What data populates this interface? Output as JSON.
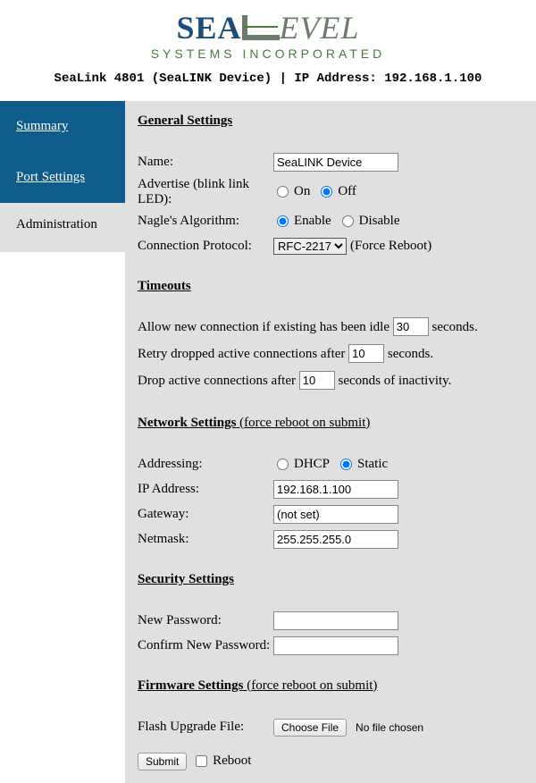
{
  "logo": {
    "brand_part1": "SEA",
    "brand_part2": "EVEL",
    "tagline": "SYSTEMS INCORPORATED"
  },
  "device_info_line": "SeaLink 4801 (SeaLINK Device)  |  IP Address: 192.168.1.100",
  "sidebar": {
    "items": [
      {
        "label": "Summary"
      },
      {
        "label": "Port Settings"
      },
      {
        "label": "Administration"
      }
    ]
  },
  "sections": {
    "general": {
      "title": "General Settings",
      "name_label": "Name:",
      "name_value": "SeaLINK Device",
      "advertise_label": "Advertise (blink link LED):",
      "advertise_on": "On",
      "advertise_off": "Off",
      "nagle_label": "Nagle's Algorithm:",
      "nagle_enable": "Enable",
      "nagle_disable": "Disable",
      "proto_label": "Connection Protocol:",
      "proto_value": "RFC-2217",
      "proto_hint": "(Force Reboot)"
    },
    "timeouts": {
      "title": "Timeouts",
      "idle_pre": "Allow new connection if existing has been idle",
      "idle_value": "30",
      "idle_post": "seconds.",
      "retry_pre": "Retry dropped active connections after",
      "retry_value": "10",
      "retry_post": "seconds.",
      "drop_pre": "Drop active connections after",
      "drop_value": "10",
      "drop_post": "seconds of inactivity."
    },
    "network": {
      "title": "Network Settings",
      "hint": " (force reboot on submit)",
      "addressing_label": "Addressing:",
      "dhcp": "DHCP",
      "static": "Static",
      "ip_label": "IP Address:",
      "ip_value": "192.168.1.100",
      "gw_label": "Gateway:",
      "gw_value": "(not set)",
      "nm_label": "Netmask:",
      "nm_value": "255.255.255.0"
    },
    "security": {
      "title": "Security Settings",
      "newpw_label": "New Password:",
      "confirmpw_label": "Confirm New Password:"
    },
    "firmware": {
      "title": "Firmware Settings",
      "hint": " (force reboot on submit)",
      "flash_label": "Flash Upgrade File:",
      "choose_btn": "Choose File",
      "file_status": "No file chosen"
    },
    "footer": {
      "submit": "Submit",
      "reboot": "Reboot"
    }
  }
}
